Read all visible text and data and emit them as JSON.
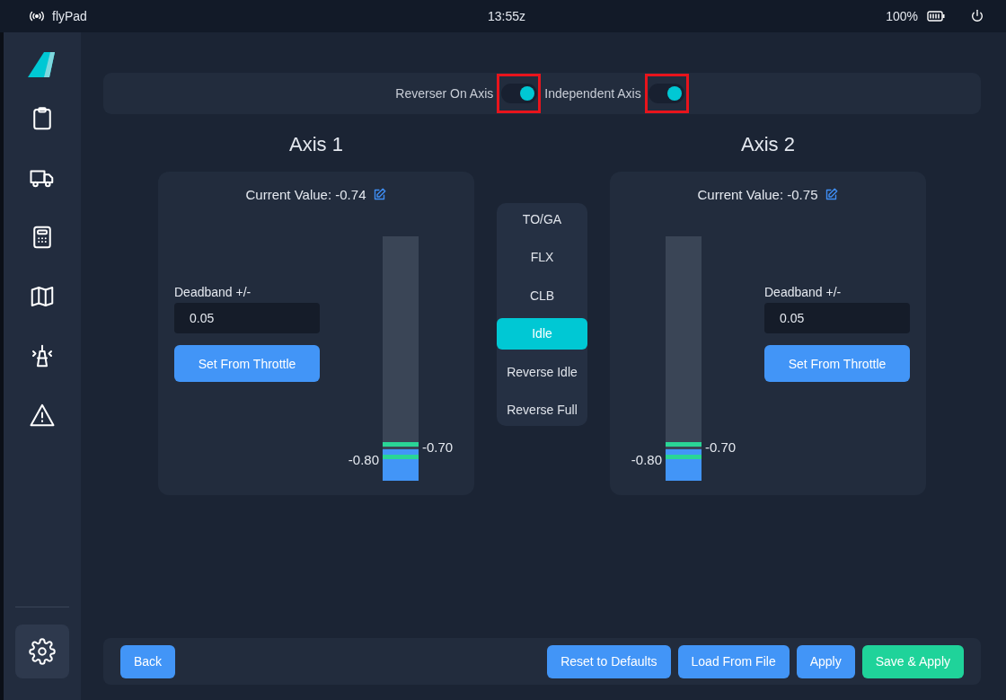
{
  "status_bar": {
    "app_name": "flyPad",
    "time": "13:55z",
    "battery": "100%"
  },
  "sidebar": {
    "items": [
      {
        "selected": false
      },
      {
        "selected": false
      },
      {
        "selected": false
      },
      {
        "selected": false
      },
      {
        "selected": false
      },
      {
        "selected": false
      }
    ],
    "settings": {
      "selected": true
    }
  },
  "toggles": [
    {
      "label": "Reverser On Axis",
      "on": true,
      "highlighted": true
    },
    {
      "label": "Independent Axis",
      "on": true,
      "highlighted": true
    }
  ],
  "axes": [
    {
      "title": "Axis 1",
      "current_value": "Current Value: -0.74",
      "kind": "barright",
      "deadband_label": "Deadband +/-",
      "deadband_value": "0.05",
      "button": "Set From Throttle",
      "level": 0.13,
      "markers": [
        {
          "label": "-0.80",
          "level": 0.096,
          "kind": "low"
        },
        {
          "label": "-0.70",
          "level": 0.147,
          "kind": "high"
        }
      ]
    },
    {
      "title": "Axis 2",
      "current_value": "Current Value: -0.75",
      "kind": "barleft",
      "deadband_label": "Deadband +/-",
      "deadband_value": "0.05",
      "button": "Set From Throttle",
      "level": 0.13,
      "markers": [
        {
          "label": "-0.80",
          "level": 0.096,
          "kind": "low"
        },
        {
          "label": "-0.70",
          "level": 0.147,
          "kind": "high"
        }
      ]
    }
  ],
  "detents": [
    {
      "label": "TO/GA",
      "selected": false
    },
    {
      "label": "FLX",
      "selected": false
    },
    {
      "label": "CLB",
      "selected": false
    },
    {
      "label": "Idle",
      "selected": true
    },
    {
      "label": "Reverse Idle",
      "selected": false
    },
    {
      "label": "Reverse Full",
      "selected": false
    }
  ],
  "footer": {
    "left": [
      {
        "label": "Back",
        "kind": "primary"
      }
    ],
    "right": [
      {
        "label": "Reset to Defaults",
        "kind": "primary"
      },
      {
        "label": "Load From File",
        "kind": "primary"
      },
      {
        "label": "Apply",
        "kind": "primary"
      },
      {
        "label": "Save & Apply",
        "kind": "success"
      }
    ]
  }
}
